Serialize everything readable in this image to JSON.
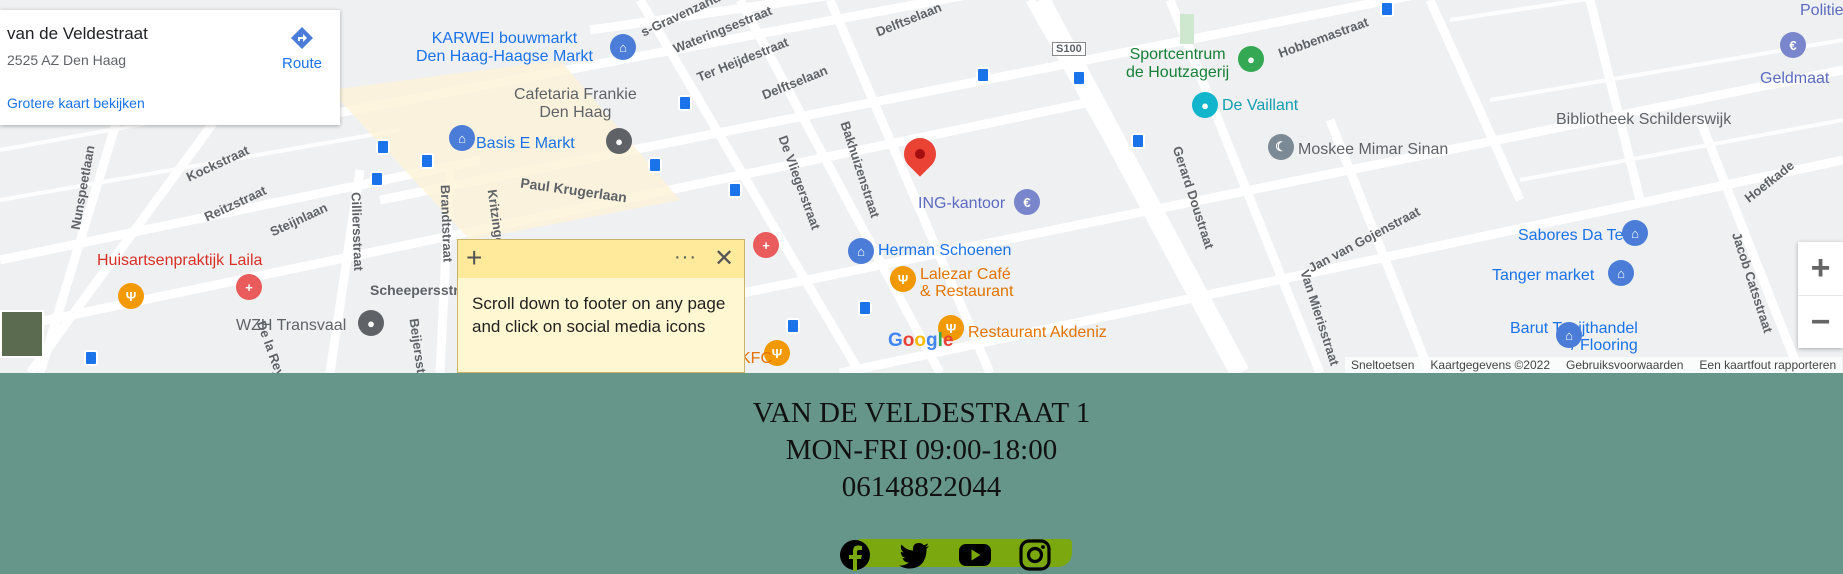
{
  "map": {
    "info_card": {
      "title": "van de Veldestraat",
      "address": "2525 AZ Den Haag",
      "route_label": "Route",
      "larger_map_link": "Grotere kaart bekijken"
    },
    "streets": {
      "s1": "Wateringsestraat",
      "s2": "Ter Heijdestraat",
      "s3": "Delftselaan",
      "s4": "Delftselaan",
      "s5": "Hobbemastraat",
      "s6": "Kockstraat",
      "s7": "Reitzstraat",
      "s8": "Steijnlaan",
      "s9": "Nunspeetlaan",
      "s10": "Cilliersstraat",
      "s11": "Brandtstraat",
      "s12": "Paul Krugerlaan",
      "s13": "Scheepersstraat",
      "s14": "De Vliegerstraat",
      "s15": "Bakhuizenstraat",
      "s16": "Gerard Doustraat",
      "s17": "Jan van Gojenstraat",
      "s18": "Van Mierisstraat",
      "s19": "Jacob Catsstraat",
      "s20": "Hoefkade",
      "s21": "S100",
      "s22": "Kritzinger",
      "s23": "Beijersstraat",
      "s24": "De la Reystraat",
      "s25": "s-Gravenzandelaan"
    },
    "pois": {
      "karwei": "KARWEI bouwmarkt\nDen Haag-Haagse Markt",
      "cafetaria": "Cafetaria Frankie\nDen Haag",
      "basis": "Basis E Markt",
      "sportcentrum": "Sportcentrum\nde Houtzagerij",
      "vaillant": "De Vaillant",
      "moskee": "Moskee Mimar Sinan",
      "bibliotheek": "Bibliotheek Schilderswijk",
      "geldmaat": "Geldmaat",
      "politie": "Politie",
      "ing": "ING-kantoor",
      "herman": "Herman Schoenen",
      "lalezar": "Lalezar Café\n& Restaurant",
      "akdeniz": "Restaurant Akdeniz",
      "huisarts": "Huisartsenpraktijk Laila",
      "wzh": "WZH Transvaal",
      "sabores": "Sabores Da Terra",
      "tanger": "Tanger market",
      "barut": "Barut Tapijthandel\n/ Flooring",
      "kfc": "KFC"
    },
    "google_logo": [
      "G",
      "o",
      "o",
      "g",
      "l",
      "e"
    ],
    "google_logo_colors": [
      "#4285f4",
      "#ea4335",
      "#fbbc05",
      "#4285f4",
      "#34a853",
      "#ea4335"
    ],
    "attribution": {
      "shortcuts": "Sneltoetsen",
      "map_data": "Kaartgegevens ©2022",
      "terms": "Gebruiksvoorwaarden",
      "report": "Een kaartfout rapporteren"
    },
    "zoom": {
      "in": "+",
      "out": "−"
    }
  },
  "sticky_note": {
    "text": "Scroll down to footer on any page and click on social media icons",
    "menu_glyph": "···",
    "add_glyph": "+",
    "close_glyph": "✕"
  },
  "footer": {
    "address": "VAN DE VELDESTRAAT 1",
    "hours": "MON-FRI 09:00-18:00",
    "phone": "06148822044",
    "social": [
      "facebook-icon",
      "twitter-icon",
      "youtube-icon",
      "instagram-icon"
    ]
  },
  "colors": {
    "footer_bg": "#66958a",
    "social_brush": "#7aa80e",
    "note_bg": "#fff7d1",
    "note_bar": "#ffe99a",
    "marker_red": "#ea4335"
  }
}
